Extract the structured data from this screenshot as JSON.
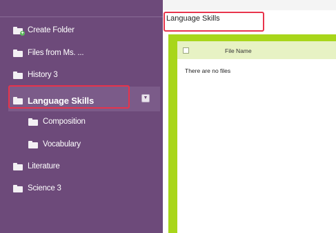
{
  "sidebar": {
    "create_folder": "Create Folder",
    "items": [
      {
        "label": "Files from Ms. ...",
        "icon": "folder-icon"
      },
      {
        "label": "History 3",
        "icon": "folder-icon"
      },
      {
        "label": "Language Skills",
        "icon": "folder-icon",
        "selected": true
      },
      {
        "label": "Composition",
        "icon": "folder-icon",
        "indent": 1
      },
      {
        "label": "Vocabulary",
        "icon": "folder-icon",
        "indent": 1
      },
      {
        "label": "Literature",
        "icon": "folder-icon"
      },
      {
        "label": "Science 3",
        "icon": "folder-icon"
      }
    ],
    "create_folder_icon": "folder-add-icon",
    "row_menu_icon": "chevron-down-icon"
  },
  "main": {
    "folder_title": "Language Skills",
    "table": {
      "columns": [
        "File Name"
      ],
      "empty_message": "There are no files"
    }
  },
  "colors": {
    "sidebar_bg": "#6d4a7a",
    "highlight_red": "#e8334b",
    "frame_green": "#a8d61a",
    "header_green": "#e7f2c4"
  }
}
